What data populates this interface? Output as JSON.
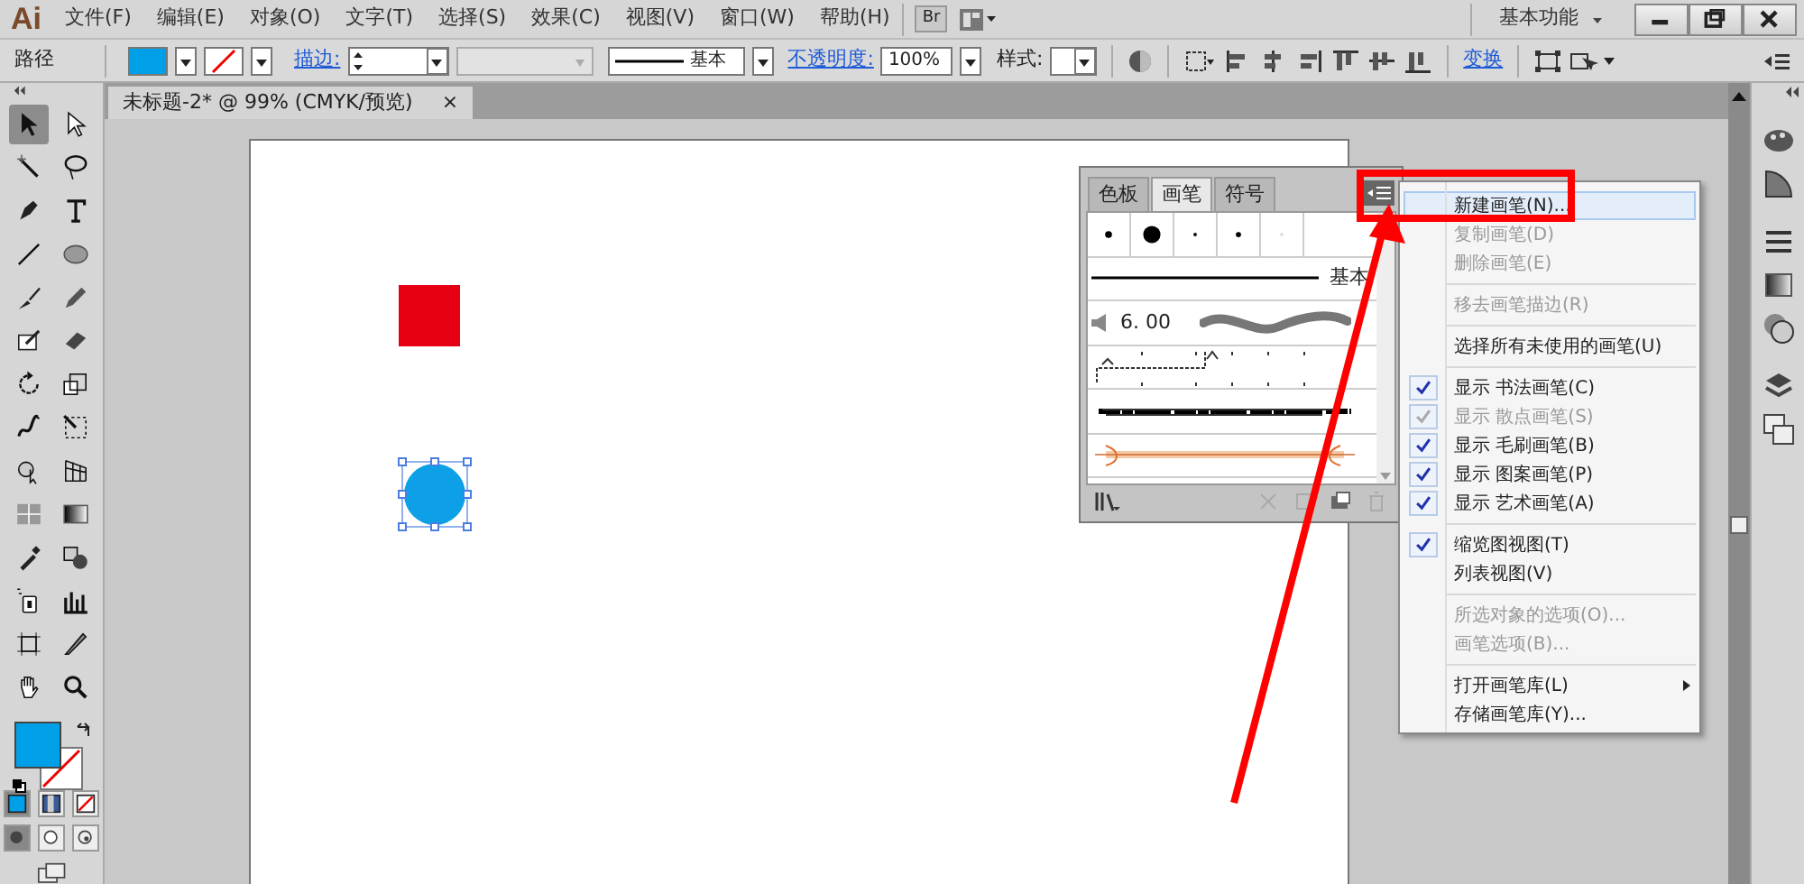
{
  "menu_bar": {
    "logo": "Ai",
    "menus": [
      "文件(F)",
      "编辑(E)",
      "对象(O)",
      "文字(T)",
      "选择(S)",
      "效果(C)",
      "视图(V)",
      "窗口(W)",
      "帮助(H)"
    ],
    "bridge_button": "Br",
    "workspace": "基本功能"
  },
  "control_bar": {
    "object_type": "路径",
    "stroke_label": "描边:",
    "stroke_profile": "基本",
    "opacity_label": "不透明度:",
    "opacity": "100%",
    "style_label": "样式:",
    "transform_link": "变换"
  },
  "toolbar": {
    "tools": [
      {
        "selected": true
      },
      {
        "selected": false
      },
      {
        "selected": false
      },
      {
        "selected": false
      },
      {
        "selected": false
      },
      {
        "selected": false
      },
      {
        "selected": false
      },
      {
        "selected": false
      },
      {
        "selected": false
      },
      {
        "selected": false
      },
      {
        "selected": false
      },
      {
        "selected": false
      },
      {
        "selected": false
      },
      {
        "selected": false
      },
      {
        "selected": false
      },
      {
        "selected": false
      },
      {
        "selected": false
      },
      {
        "selected": false
      },
      {
        "selected": false
      },
      {
        "selected": false
      },
      {
        "selected": false
      },
      {
        "selected": false
      },
      {
        "selected": false
      },
      {
        "selected": false
      },
      {
        "selected": false
      },
      {
        "selected": false
      },
      {
        "selected": false
      },
      {
        "selected": false
      }
    ],
    "color_modes": [
      {
        "selected": true
      },
      {
        "selected": false
      },
      {
        "selected": false
      }
    ],
    "draw_modes": [
      {
        "selected": true
      },
      {
        "selected": false
      },
      {
        "selected": false
      }
    ]
  },
  "document_tab": {
    "title": "未标题-2* @ 99% (CMYK/预览)",
    "close": "×"
  },
  "artboard": {
    "objects": [
      {
        "kind": "rectangle",
        "color": "#e60012",
        "selected": false
      },
      {
        "kind": "ellipse",
        "color": "#0ea0e6",
        "selected": true
      }
    ]
  },
  "brushes_panel": {
    "tabs": [
      {
        "label": "色板",
        "selected": false
      },
      {
        "label": "画笔",
        "selected": true
      },
      {
        "label": "符号",
        "selected": false
      }
    ],
    "rows": [
      {
        "kind": "dots"
      },
      {
        "kind": "line",
        "label": "基本"
      },
      {
        "kind": "calligraphic",
        "size": "6. 00"
      },
      {
        "kind": "scatter"
      },
      {
        "kind": "bristle"
      },
      {
        "kind": "art"
      }
    ]
  },
  "flyout_menu": {
    "items": [
      {
        "kind": "item",
        "label": "新建画笔(N)...",
        "disabled": false,
        "checked": false,
        "highlighted": true
      },
      {
        "kind": "item",
        "label": "复制画笔(D)",
        "disabled": true,
        "checked": false,
        "highlighted": false
      },
      {
        "kind": "item",
        "label": "删除画笔(E)",
        "disabled": true,
        "checked": false,
        "highlighted": false
      },
      {
        "kind": "separator"
      },
      {
        "kind": "item",
        "label": "移去画笔描边(R)",
        "disabled": true,
        "checked": false,
        "highlighted": false
      },
      {
        "kind": "separator"
      },
      {
        "kind": "item",
        "label": "选择所有未使用的画笔(U)",
        "disabled": false,
        "checked": false,
        "highlighted": false
      },
      {
        "kind": "separator"
      },
      {
        "kind": "item",
        "label": "显示 书法画笔(C)",
        "disabled": false,
        "checked": true,
        "highlighted": false
      },
      {
        "kind": "item",
        "label": "显示 散点画笔(S)",
        "disabled": true,
        "checked": true,
        "highlighted": false
      },
      {
        "kind": "item",
        "label": "显示 毛刷画笔(B)",
        "disabled": false,
        "checked": true,
        "highlighted": false
      },
      {
        "kind": "item",
        "label": "显示 图案画笔(P)",
        "disabled": false,
        "checked": true,
        "highlighted": false
      },
      {
        "kind": "item",
        "label": "显示 艺术画笔(A)",
        "disabled": false,
        "checked": true,
        "highlighted": false
      },
      {
        "kind": "separator"
      },
      {
        "kind": "item",
        "label": "缩览图视图(T)",
        "disabled": false,
        "checked": true,
        "highlighted": false
      },
      {
        "kind": "item",
        "label": "列表视图(V)",
        "disabled": false,
        "checked": false,
        "highlighted": false
      },
      {
        "kind": "separator"
      },
      {
        "kind": "item",
        "label": "所选对象的选项(O)...",
        "disabled": true,
        "checked": false,
        "highlighted": false
      },
      {
        "kind": "item",
        "label": "画笔选项(B)...",
        "disabled": true,
        "checked": false,
        "highlighted": false
      },
      {
        "kind": "separator"
      },
      {
        "kind": "item",
        "label": "打开画笔库(L)",
        "disabled": false,
        "checked": false,
        "highlighted": false,
        "submenu": true
      },
      {
        "kind": "item",
        "label": "存储画笔库(Y)...",
        "disabled": false,
        "checked": false,
        "highlighted": false
      }
    ]
  }
}
